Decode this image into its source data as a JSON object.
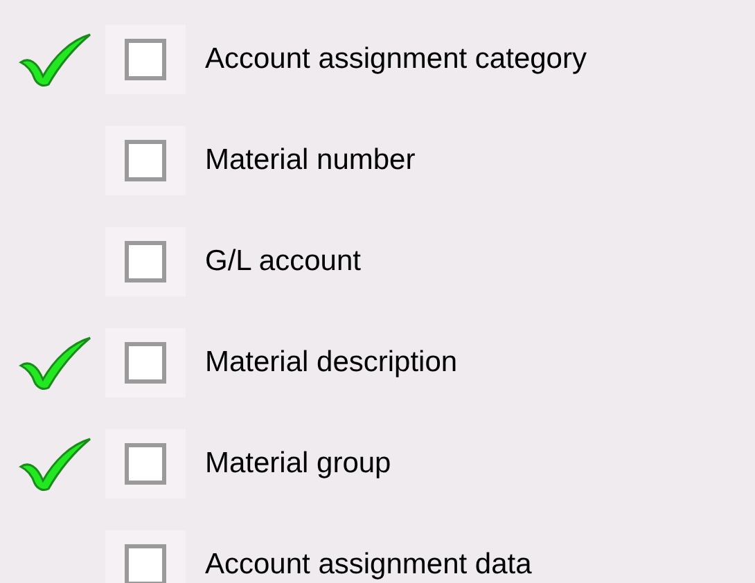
{
  "items": [
    {
      "label": "Account assignment category",
      "marked": true,
      "checked": false
    },
    {
      "label": "Material number",
      "marked": false,
      "checked": false
    },
    {
      "label": "G/L account",
      "marked": false,
      "checked": false
    },
    {
      "label": "Material description",
      "marked": true,
      "checked": false
    },
    {
      "label": "Material group",
      "marked": true,
      "checked": false
    },
    {
      "label": "Account assignment data",
      "marked": false,
      "checked": false
    }
  ]
}
